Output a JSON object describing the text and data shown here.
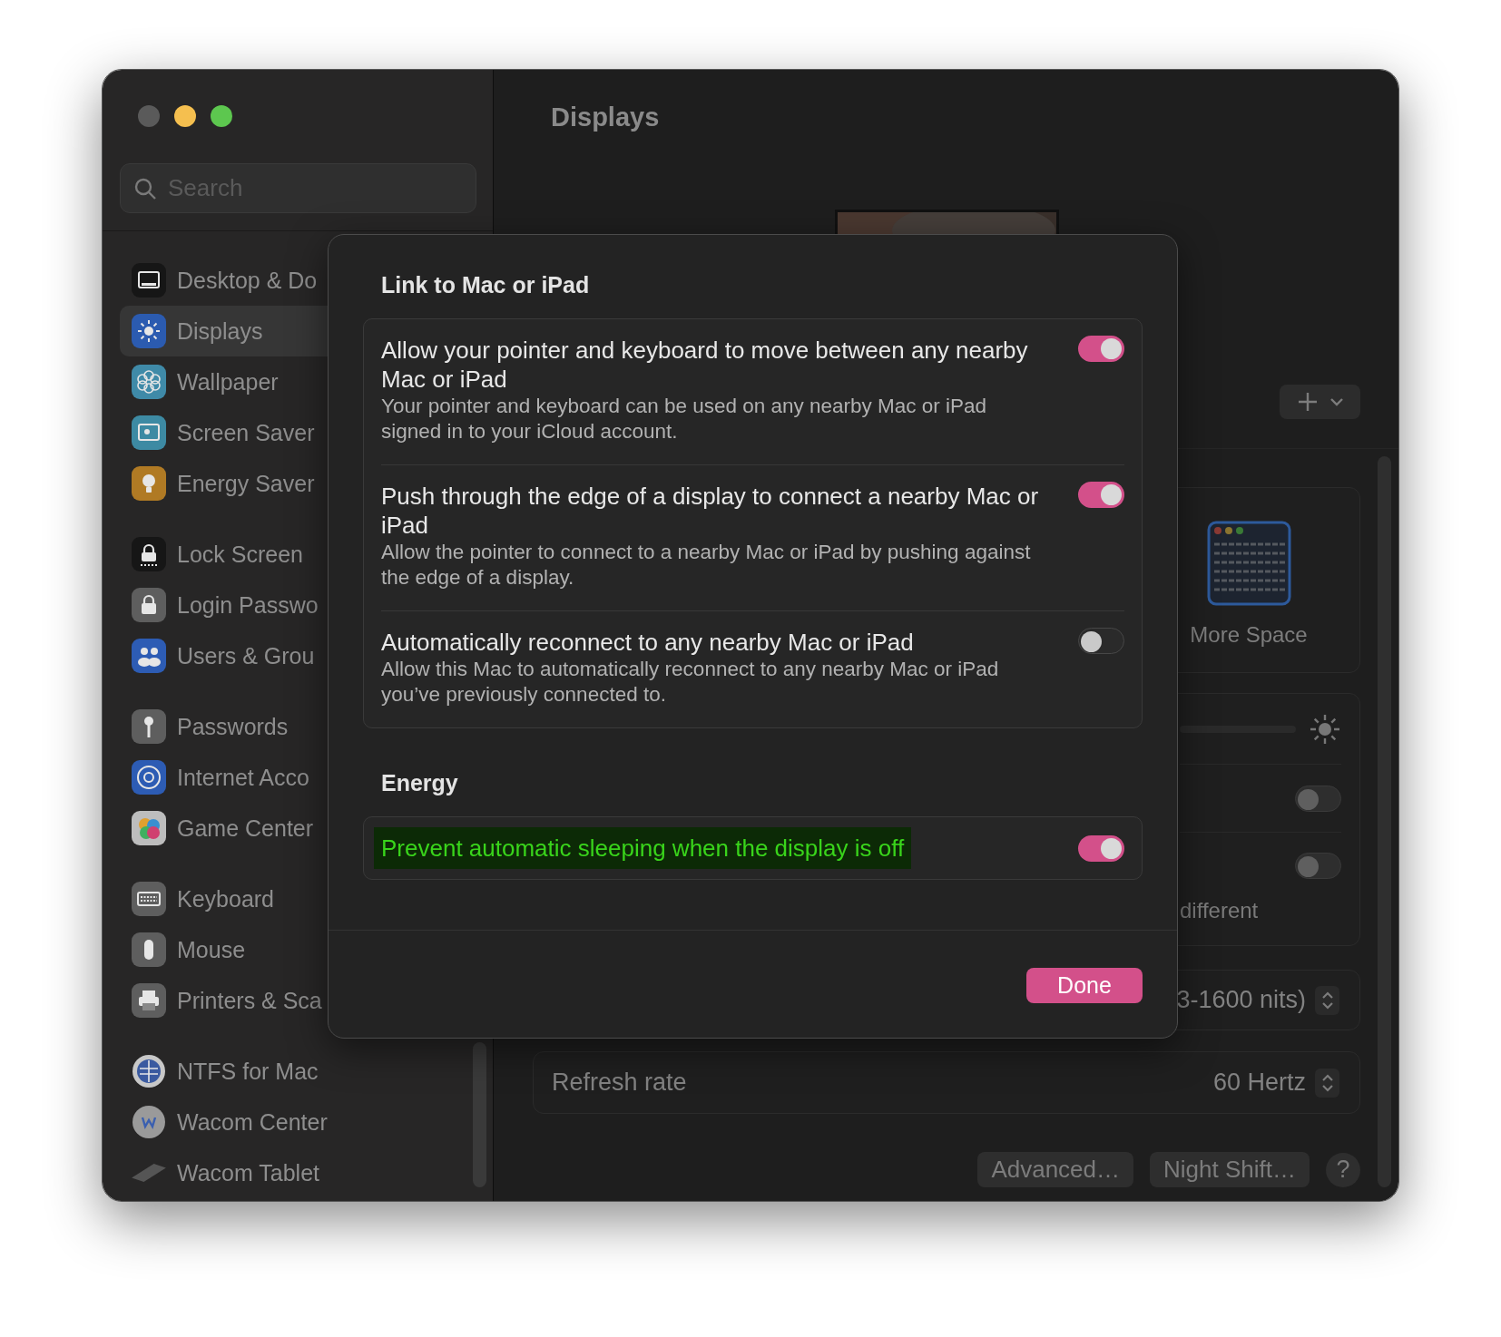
{
  "window": {
    "title": "Displays"
  },
  "sidebar": {
    "search": {
      "placeholder": "Search"
    },
    "groups": [
      {
        "items": [
          {
            "label": "Desktop & Do",
            "selected": false,
            "color": "#161616"
          },
          {
            "label": "Displays",
            "selected": true,
            "color": "#2b5bb0"
          },
          {
            "label": "Wallpaper",
            "selected": false,
            "color": "#3f8aa8"
          },
          {
            "label": "Screen Saver",
            "selected": false,
            "color": "#3d8aa3"
          },
          {
            "label": "Energy Saver",
            "selected": false,
            "color": "#b07a24"
          }
        ]
      },
      {
        "items": [
          {
            "label": "Lock Screen",
            "selected": false,
            "color": "#161616"
          },
          {
            "label": "Login Passwo",
            "selected": false,
            "color": "#5e5e5e"
          },
          {
            "label": "Users & Grou",
            "selected": false,
            "color": "#2d5cb4"
          }
        ]
      },
      {
        "items": [
          {
            "label": "Passwords",
            "selected": false,
            "color": "#5e5e5e"
          },
          {
            "label": "Internet Acco",
            "selected": false,
            "color": "#2d5cb4"
          },
          {
            "label": "Game Center",
            "selected": false,
            "color": "#bdbdbd"
          }
        ]
      },
      {
        "items": [
          {
            "label": "Keyboard",
            "selected": false,
            "color": "#5e5e5e"
          },
          {
            "label": "Mouse",
            "selected": false,
            "color": "#5e5e5e"
          },
          {
            "label": "Printers & Sca",
            "selected": false,
            "color": "#5e5e5e"
          }
        ]
      },
      {
        "items": [
          {
            "label": "NTFS for Mac",
            "selected": false,
            "color": "#c8c8c8"
          },
          {
            "label": "Wacom Center",
            "selected": false,
            "color": "#9a9a9a"
          },
          {
            "label": "Wacom Tablet",
            "selected": false,
            "color": "#555555"
          }
        ]
      }
    ]
  },
  "main": {
    "arrangement": {
      "label": "More Space"
    },
    "toggles": [
      {
        "on": false
      },
      {
        "on": false,
        "note": "different"
      }
    ],
    "brightness": {
      "value": "3-1600 nits)"
    },
    "refresh_rate": {
      "label": "Refresh rate",
      "value": "60 Hertz"
    },
    "buttons": [
      "Advanced…",
      "Night Shift…"
    ],
    "help": "?"
  },
  "dialog": {
    "sections": [
      {
        "title": "Link to Mac or iPad",
        "rows": [
          {
            "title": "Allow your pointer and keyboard to move between any nearby Mac or iPad",
            "description": "Your pointer and keyboard can be used on any nearby Mac or iPad signed in to your iCloud account.",
            "on": true,
            "highlighted": false
          },
          {
            "title": "Push through the edge of a display to connect a nearby Mac or iPad",
            "description": "Allow the pointer to connect to a nearby Mac or iPad by pushing against the edge of a display.",
            "on": true,
            "highlighted": false
          },
          {
            "title": "Automatically reconnect to any nearby Mac or iPad",
            "description": "Allow this Mac to automatically reconnect to any nearby Mac or iPad you’ve previously connected to.",
            "on": false,
            "highlighted": false
          }
        ]
      },
      {
        "title": "Energy",
        "rows": [
          {
            "title": "Prevent automatic sleeping when the display is off",
            "on": true,
            "highlighted": true
          }
        ]
      }
    ],
    "done_button": "Done"
  }
}
